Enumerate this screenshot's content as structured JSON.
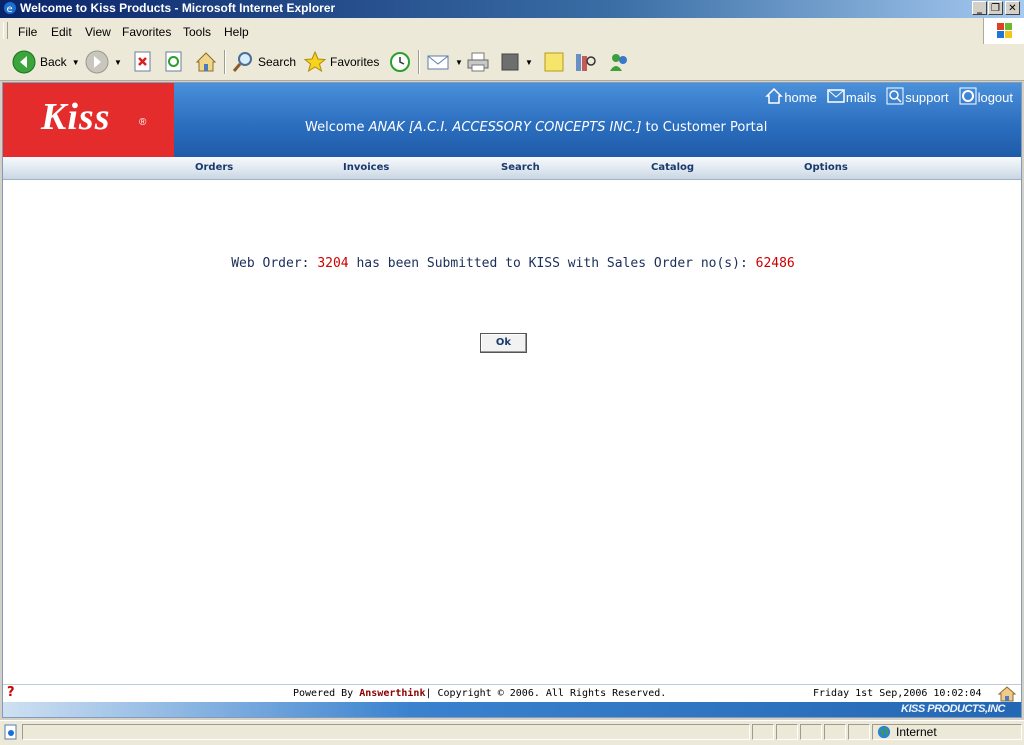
{
  "window": {
    "title": "Welcome to Kiss Products - Microsoft Internet Explorer"
  },
  "menu": [
    "File",
    "Edit",
    "View",
    "Favorites",
    "Tools",
    "Help"
  ],
  "toolbar": {
    "back": "Back",
    "search": "Search",
    "favorites": "Favorites"
  },
  "header": {
    "logo": "Kiss",
    "logo_mark": "®",
    "links": {
      "home": "home",
      "mails": "mails",
      "support": "support",
      "logout": "logout"
    },
    "welcome_prefix": "Welcome ",
    "company": "ANAK [A.C.I. ACCESSORY CONCEPTS INC.]",
    "welcome_suffix": " to Customer Portal"
  },
  "nav": [
    "Orders",
    "Invoices",
    "Search",
    "Catalog",
    "Options"
  ],
  "message": {
    "prefix": "Web Order: ",
    "order_no": "3204",
    "middle": " has been Submitted to KISS with Sales Order no(s): ",
    "sales_order_no": "62486"
  },
  "ok_button": "Ok",
  "footer": {
    "help": "?",
    "powered_by": "Powered By ",
    "brand": "Answerthink",
    "copyright": "| Copyright © 2006. All Rights Reserved.",
    "datetime": "Friday 1st Sep,2006 10:02:04",
    "corp": "KISS PRODUCTS,INC"
  },
  "status": {
    "zone": "Internet"
  },
  "colors": {
    "brand_red": "#e52c2c",
    "header_blue": "#2c6fc0",
    "highlight_red": "#cc0000"
  }
}
